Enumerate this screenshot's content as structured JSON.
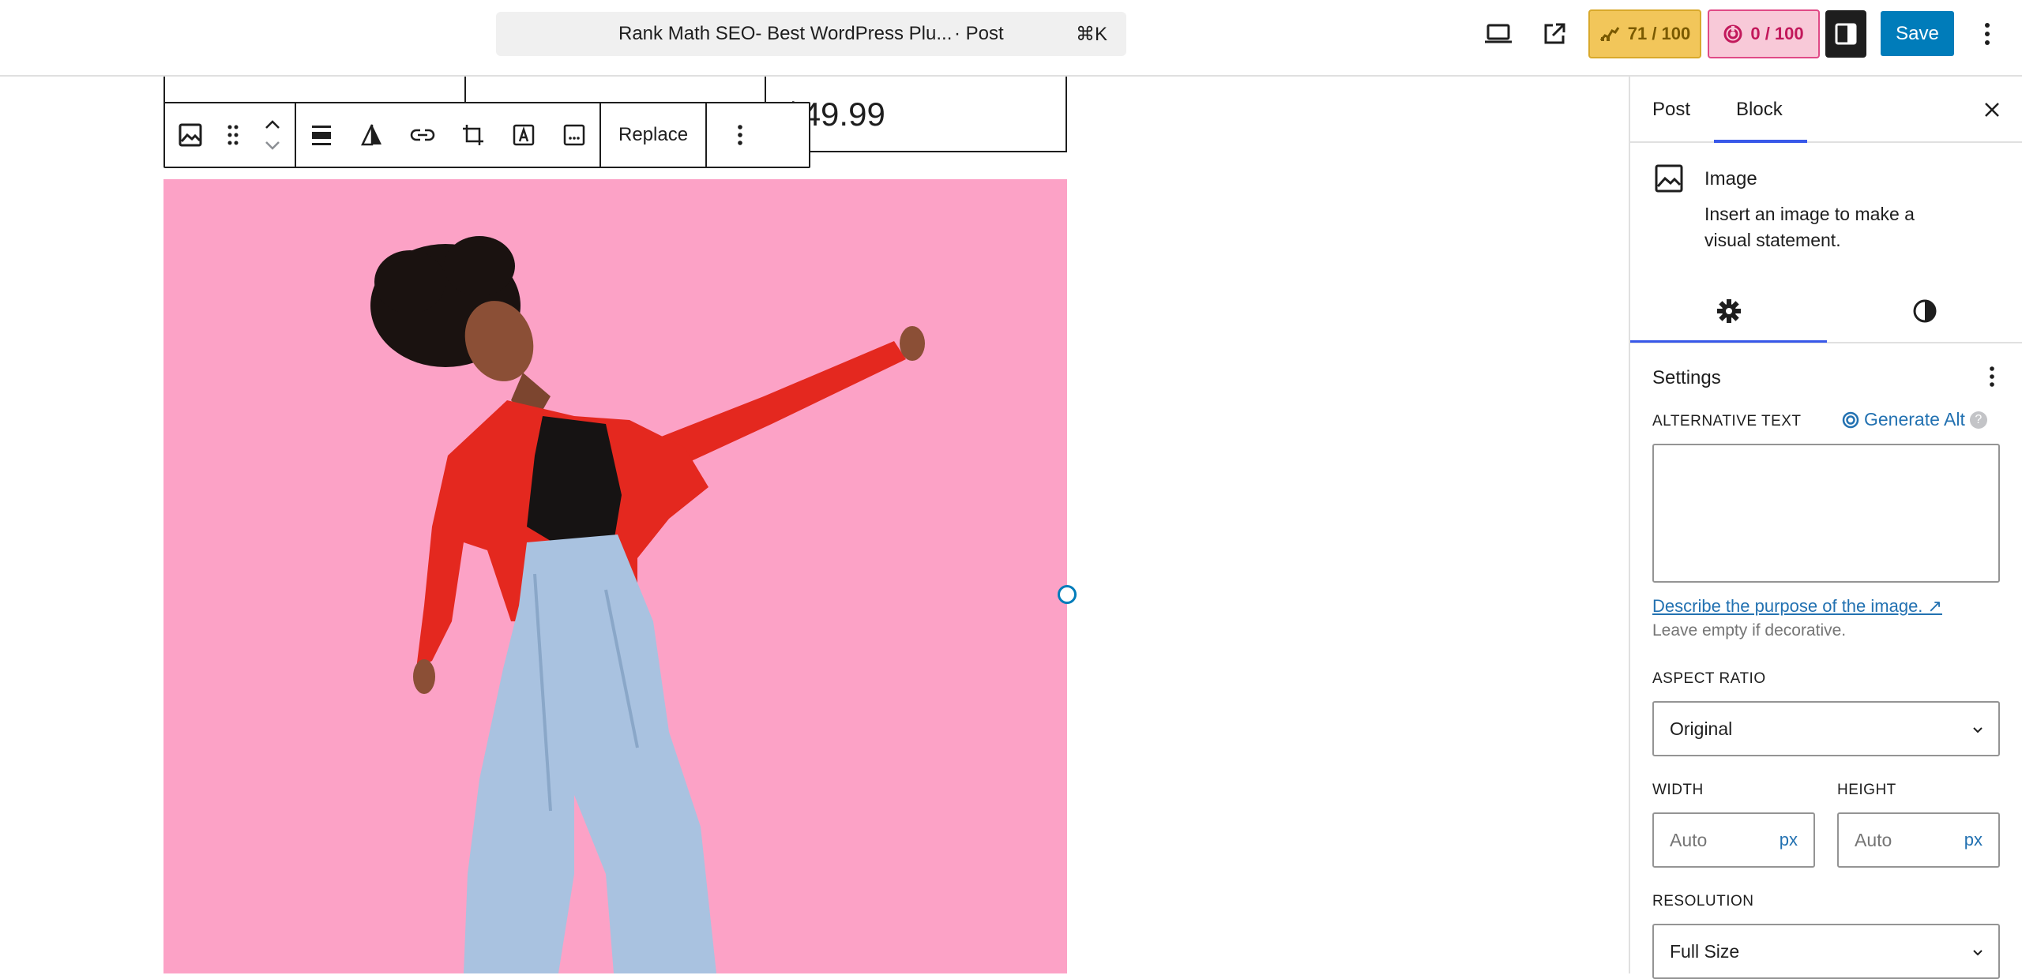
{
  "header": {
    "document_title": "Rank Math SEO- Best WordPress Plu...",
    "document_type": "· Post",
    "shortcut": "⌘K",
    "seo_score": "71 / 100",
    "ai_score": "0 / 100",
    "save_label": "Save",
    "icons": [
      "laptop-icon",
      "external-link-icon",
      "rank-math-icon",
      "content-ai-icon",
      "sidebar-icon",
      "more-vertical-icon"
    ]
  },
  "canvas": {
    "table_price": "$49.99",
    "toolbar": {
      "replace_label": "Replace",
      "icons": [
        "image-icon",
        "drag-handle-icon",
        "move-up-icon",
        "move-down-icon",
        "align-icon",
        "duotone-icon",
        "link-icon",
        "crop-icon",
        "text-overlay-icon",
        "caption-icon",
        "more-vertical-icon"
      ]
    }
  },
  "sidebar": {
    "tabs": [
      {
        "label": "Post"
      },
      {
        "label": "Block"
      }
    ],
    "block_card": {
      "title": "Image",
      "description": "Insert an image to make a visual statement."
    },
    "settings_title": "Settings",
    "alt_text": {
      "label": "ALTERNATIVE TEXT",
      "generate_label": "Generate Alt",
      "value": "",
      "describe_link": "Describe the purpose of the image. ↗",
      "help": "Leave empty if decorative."
    },
    "aspect_ratio": {
      "label": "ASPECT RATIO",
      "value": "Original"
    },
    "width": {
      "label": "WIDTH",
      "placeholder": "Auto",
      "unit": "px"
    },
    "height": {
      "label": "HEIGHT",
      "placeholder": "Auto",
      "unit": "px"
    },
    "resolution": {
      "label": "RESOLUTION",
      "value": "Full Size"
    }
  },
  "colors": {
    "accent": "#007cba",
    "wp_blue": "#3858e9",
    "image_bg": "#fca2c6",
    "seo_badge": "#f2c65a",
    "ai_badge": "#f8c9d8",
    "annotation_arrow": "#7b4fd6"
  }
}
